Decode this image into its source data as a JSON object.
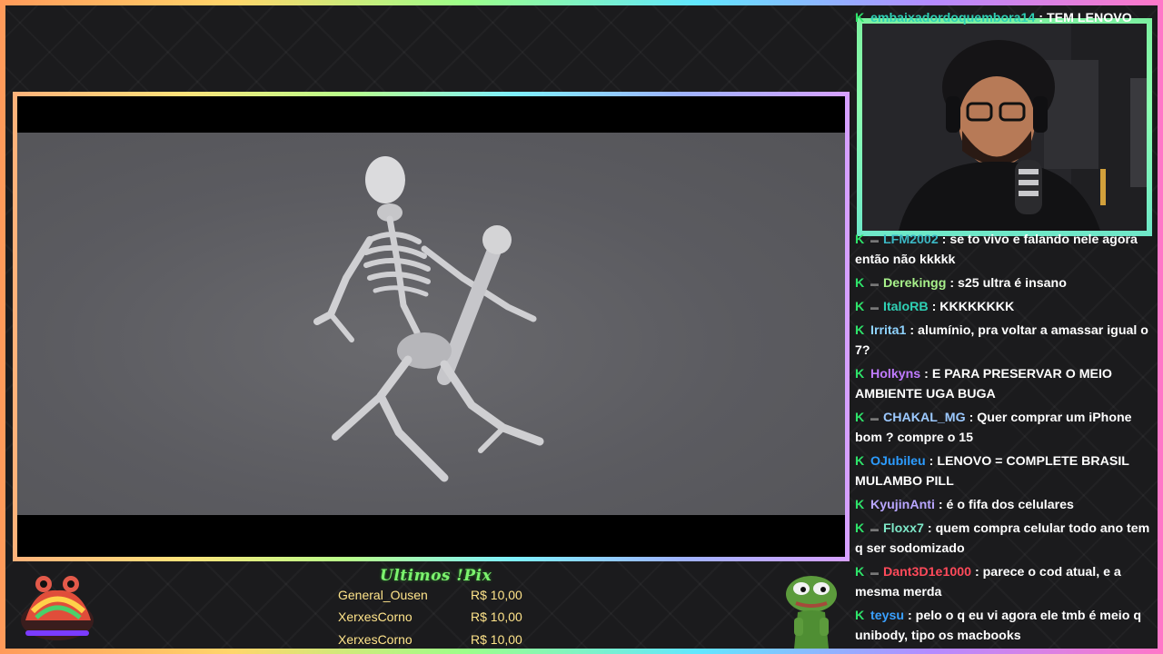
{
  "chat": {
    "top_partial": {
      "user": "embaixadordoquembora14",
      "text": ": TEM LENOVO"
    },
    "messages": [
      {
        "user": "LFM2002",
        "color": "#3bb7c4",
        "text": ": se to vivo e falando nele agora então não kkkkk"
      },
      {
        "user": "Derekingg",
        "color": "#a7f08a",
        "text": ": s25 ultra é insano"
      },
      {
        "user": "ItaloRB",
        "color": "#2fd1b5",
        "text": ": KKKKKKKK"
      },
      {
        "user": "Irrita1",
        "color": "#8fd3ff",
        "text": ": alumínio, pra voltar a amassar igual o 7?"
      },
      {
        "user": "Holkyns",
        "color": "#c07bff",
        "text": ": E PARA PRESERVAR O MEIO AMBIENTE UGA BUGA"
      },
      {
        "user": "CHAKAL_MG",
        "color": "#9cc9ff",
        "text": ": Quer comprar um iPhone bom ? compre o 15"
      },
      {
        "user": "OJubileu",
        "color": "#2c9cff",
        "text": ": LENOVO = COMPLETE BRASIL MULAMBO PILL"
      },
      {
        "user": "KyujinAnti",
        "color": "#b9a6ff",
        "text": ": é o fifa dos celulares"
      },
      {
        "user": "Floxx7",
        "color": "#7ee8c8",
        "text": ": quem compra celular todo ano tem q ser sodomizado"
      },
      {
        "user": "Dant3D1e1000",
        "color": "#ff4a5a",
        "text": ": parece o cod atual, e a mesma merda"
      },
      {
        "user": "teysu",
        "color": "#3aa0ff",
        "text": ": pelo o q eu vi agora ele tmb é meio q unibody, tipo os macbooks"
      }
    ]
  },
  "tips": {
    "title": "Ultimos !Pix",
    "entries": [
      {
        "name": "General_Ousen",
        "amount": "R$ 10,00"
      },
      {
        "name": "XerxesCorno",
        "amount": "R$ 10,00"
      },
      {
        "name": "XerxesCorno",
        "amount": "R$ 10,00"
      }
    ]
  },
  "icons": {
    "chat_badge": "kick-k-icon",
    "skeleton": "dancing-skeleton-icon",
    "frog": "rainbow-frog-mascot",
    "pepe": "pepe-frog-mascot"
  }
}
